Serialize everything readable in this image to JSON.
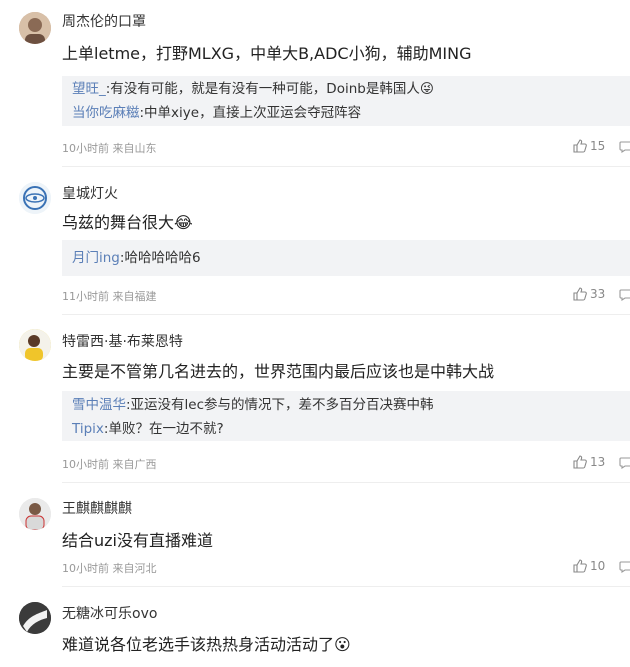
{
  "comments": [
    {
      "username": "周杰伦的口罩",
      "text": "上单letme，打野MLXG，中单大B,ADC小狗，辅助MING",
      "replies": [
        {
          "name": "望旺_",
          "text": ":有没有可能，就是有没有一种可能，Doinb是韩国人😜"
        },
        {
          "name": "当你吃麻糍",
          "text": ":中单xiye，直接上次亚运会夺冠阵容"
        }
      ],
      "time": "10小时前",
      "location": "来自山东",
      "likes": "15"
    },
    {
      "username": "皇城灯火",
      "text": "乌兹的舞台很大😂",
      "replies": [
        {
          "name": "月门ing",
          "text": ":哈哈哈哈哈6"
        }
      ],
      "time": "11小时前",
      "location": "来自福建",
      "likes": "33"
    },
    {
      "username": "特雷西·基·布莱恩特",
      "text": "主要是不管第几名进去的，世界范围内最后应该也是中韩大战",
      "replies": [
        {
          "name": "雪中温华",
          "text": ":亚运没有lec参与的情况下，差不多百分百决赛中韩"
        },
        {
          "name": "Tipix",
          "text": ":单败？在一边不就?"
        }
      ],
      "time": "10小时前",
      "location": "来自广西",
      "likes": "13"
    },
    {
      "username": "王麒麒麒麒",
      "text": "结合uzi没有直播难道",
      "replies": [],
      "time": "10小时前",
      "location": "来自河北",
      "likes": "10"
    },
    {
      "username": "无糖冰可乐ovo",
      "text": "难道说各位老选手该热热身活动活动了😮",
      "replies": [],
      "time": "",
      "location": "",
      "likes": ""
    }
  ]
}
